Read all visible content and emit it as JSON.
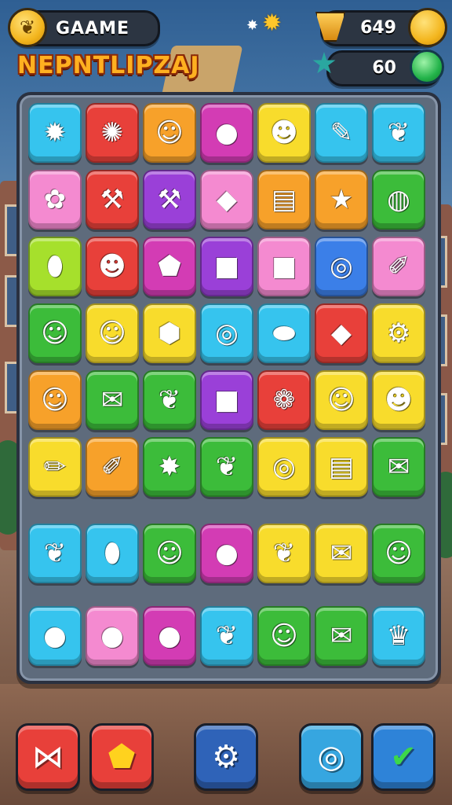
{
  "hud": {
    "title": "GAAME",
    "logo": "NEPNTLIPZAJ",
    "score_value": "649",
    "gems_value": "60"
  },
  "colors": {
    "red": "#e8403a",
    "orange": "#f7a12a",
    "yellow": "#f8dc2c",
    "lime": "#a6e02c",
    "green": "#3cbc3a",
    "cyan": "#36c4ee",
    "blue": "#3b7fe8",
    "purple": "#9a40d8",
    "pink": "#f48ad0",
    "magenta": "#d33cb4"
  },
  "board": {
    "rows": [
      [
        {
          "color": "cyan",
          "icon": "sun-icon"
        },
        {
          "color": "red",
          "icon": "starburst-icon"
        },
        {
          "color": "orange",
          "icon": "smiley-icon"
        },
        {
          "color": "magenta",
          "icon": "apple-icon"
        },
        {
          "color": "yellow",
          "icon": "blob-face-icon"
        },
        {
          "color": "cyan",
          "icon": "pen-icon"
        },
        {
          "color": "cyan",
          "icon": "leaf-icon"
        }
      ],
      [
        {
          "color": "pink",
          "icon": "blob-icon"
        },
        {
          "color": "red",
          "icon": "wrench-icon"
        },
        {
          "color": "purple",
          "icon": "wrench-icon"
        },
        {
          "color": "pink",
          "icon": "drop-icon"
        },
        {
          "color": "orange",
          "icon": "book-icon"
        },
        {
          "color": "orange",
          "icon": "star-icon"
        },
        {
          "color": "green",
          "icon": "globe-icon"
        }
      ],
      [
        {
          "color": "lime",
          "icon": "balloon-icon"
        },
        {
          "color": "red",
          "icon": "blob-face-icon"
        },
        {
          "color": "magenta",
          "icon": "gem-icon"
        },
        {
          "color": "purple",
          "icon": "square-icon"
        },
        {
          "color": "pink",
          "icon": "square-icon"
        },
        {
          "color": "blue",
          "icon": "ring-icon"
        },
        {
          "color": "pink",
          "icon": "pencil-icon"
        }
      ],
      [
        {
          "color": "green",
          "icon": "smiley-icon"
        },
        {
          "color": "yellow",
          "icon": "smiley-icon"
        },
        {
          "color": "yellow",
          "icon": "crayon-icon"
        },
        {
          "color": "cyan",
          "icon": "ring-icon"
        },
        {
          "color": "cyan",
          "icon": "lemon-icon"
        },
        {
          "color": "red",
          "icon": "diamond-icon"
        },
        {
          "color": "yellow",
          "icon": "gear-square-icon"
        }
      ],
      [
        {
          "color": "orange",
          "icon": "smiley-icon"
        },
        {
          "color": "green",
          "icon": "chat-icon"
        },
        {
          "color": "green",
          "icon": "leaf-icon"
        },
        {
          "color": "purple",
          "icon": "square-icon"
        },
        {
          "color": "red",
          "icon": "flower-icon"
        },
        {
          "color": "yellow",
          "icon": "smiley-icon"
        },
        {
          "color": "yellow",
          "icon": "blob-face-icon"
        }
      ],
      [
        {
          "color": "yellow",
          "icon": "brush-icon"
        },
        {
          "color": "orange",
          "icon": "pencil-icon"
        },
        {
          "color": "green",
          "icon": "sun-face-icon"
        },
        {
          "color": "green",
          "icon": "leaf-icon"
        },
        {
          "color": "yellow",
          "icon": "ring-icon"
        },
        {
          "color": "yellow",
          "icon": "book-icon"
        },
        {
          "color": "green",
          "icon": "chat-icon"
        }
      ],
      [
        {
          "color": "cyan",
          "icon": "leaf-icon"
        },
        {
          "color": "cyan",
          "icon": "balloon-icon"
        },
        {
          "color": "green",
          "icon": "smiley-icon"
        },
        {
          "color": "magenta",
          "icon": "apple-icon"
        },
        {
          "color": "yellow",
          "icon": "leaf-icon"
        },
        {
          "color": "yellow",
          "icon": "chat-icon"
        },
        {
          "color": "green",
          "icon": "smiley-icon"
        }
      ],
      [
        {
          "color": "cyan",
          "icon": "orb-icon"
        },
        {
          "color": "pink",
          "icon": "apple-icon"
        },
        {
          "color": "magenta",
          "icon": "apple-icon"
        },
        {
          "color": "cyan",
          "icon": "leaf-icon"
        },
        {
          "color": "green",
          "icon": "smiley-icon"
        },
        {
          "color": "green",
          "icon": "chat-icon"
        },
        {
          "color": "cyan",
          "icon": "crown-icon"
        }
      ]
    ]
  },
  "buttons": [
    {
      "name": "bow-button",
      "icon": "bow-icon",
      "color": "#e8403a"
    },
    {
      "name": "shield-button",
      "icon": "shield-icon",
      "color": "#e8403a"
    },
    {
      "name": "settings-button",
      "icon": "gear-icon",
      "color": "#2f63b8"
    },
    {
      "name": "target-button",
      "icon": "target-icon",
      "color": "#36a6e0"
    },
    {
      "name": "confirm-button",
      "icon": "check-icon",
      "color": "#2e83d8"
    }
  ]
}
